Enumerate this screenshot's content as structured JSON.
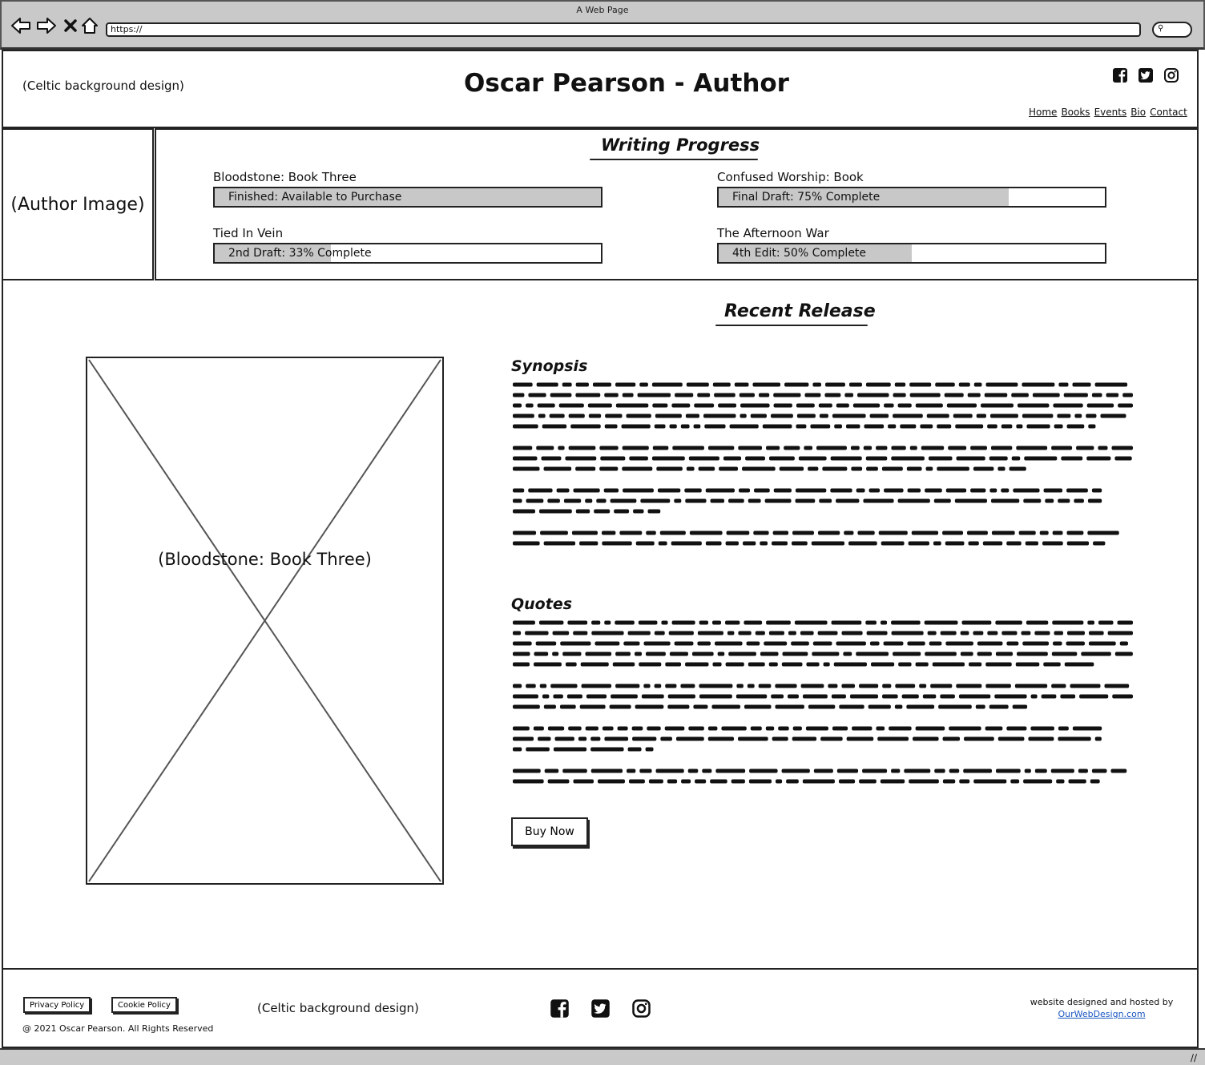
{
  "browser": {
    "window_title": "A Web Page",
    "url": "https://"
  },
  "header": {
    "background_note": "(Celtic background design)",
    "title": "Oscar Pearson - Author",
    "social": [
      "facebook-icon",
      "twitter-icon",
      "instagram-icon"
    ],
    "nav": [
      "Home",
      "Books",
      "Events",
      "Bio",
      "Contact"
    ]
  },
  "author_image_label": "(Author Image)",
  "writing_progress": {
    "heading": "Writing Progress",
    "items": [
      {
        "title": "Bloodstone: Book Three",
        "status": "Finished: Available to Purchase",
        "progress": 1.0
      },
      {
        "title": "Confused Worship: Book",
        "status": "Final Draft: 75% Complete",
        "progress": 0.75
      },
      {
        "title": "Tied In Vein",
        "status": "2nd Draft: 33% Complete",
        "progress": 0.3
      },
      {
        "title": "The Afternoon War",
        "status": "4th Edit: 50% Complete",
        "progress": 0.5
      }
    ]
  },
  "recent_release": {
    "heading": "Recent Release",
    "cover_label": "(Bloodstone: Book Three)",
    "synopsis_heading": "Synopsis",
    "quotes_heading": "Quotes",
    "buy_label": "Buy Now"
  },
  "footer": {
    "privacy_label": "Privacy Policy",
    "cookie_label": "Cookie Policy",
    "copyright": "@ 2021 Oscar Pearson. All Rights Reserved",
    "background_note": "(Celtic background design)",
    "credit_line": "website designed and hosted by",
    "credit_link": "OurWebDesign.com"
  },
  "colors": {
    "progress_fill": "#c8c8c8",
    "chrome": "#c9c9c9",
    "link": "#1a56c0"
  }
}
